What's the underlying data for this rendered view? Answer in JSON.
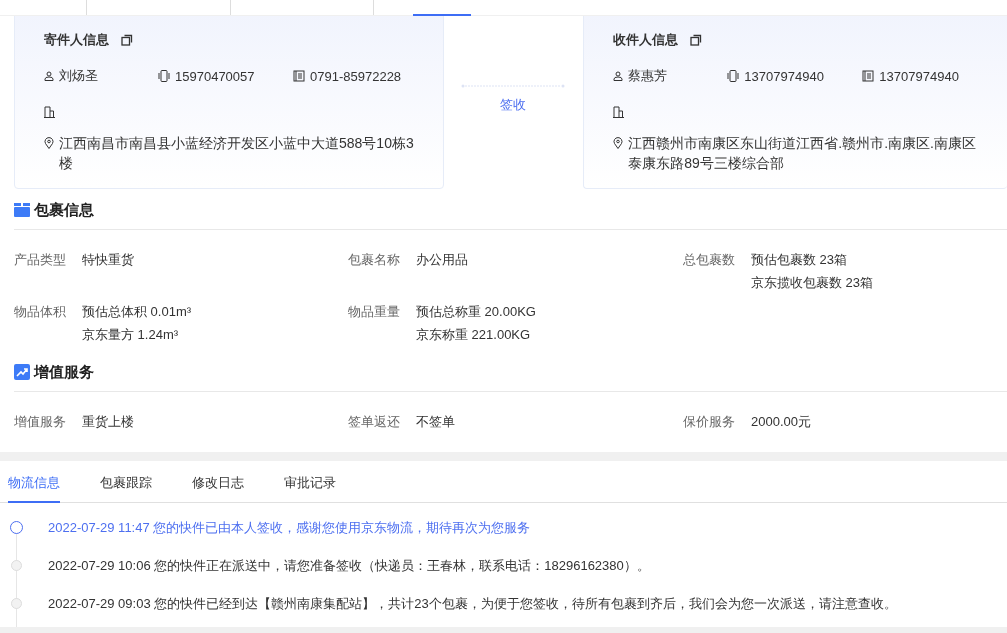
{
  "top_tabs": [
    {
      "selected": false
    },
    {
      "selected": false
    },
    {
      "selected": false
    },
    {
      "selected": true
    }
  ],
  "sender": {
    "title": "寄件人信息",
    "name": "刘炀圣",
    "mobile": "15970470057",
    "phone": "0791-85972228",
    "address": "江西南昌市南昌县小蓝经济开发区小蓝中大道588号10栋3楼"
  },
  "route": {
    "status": "签收"
  },
  "receiver": {
    "title": "收件人信息",
    "name": "蔡惠芳",
    "mobile": "13707974940",
    "phone": "13707974940",
    "address": "江西赣州市南康区东山街道江西省.赣州市.南康区.南康区泰康东路89号三楼综合部"
  },
  "package_section": {
    "title": "包裹信息",
    "fields": [
      {
        "label": "产品类型",
        "values": [
          "特快重货"
        ]
      },
      {
        "label": "包裹名称",
        "values": [
          "办公用品"
        ]
      },
      {
        "label": "总包裹数",
        "values": [
          "预估包裹数 23箱",
          "京东揽收包裹数 23箱"
        ]
      },
      {
        "label": "物品体积",
        "values": [
          "预估总体积 0.01m³",
          "京东量方 1.24m³"
        ]
      },
      {
        "label": "物品重量",
        "values": [
          "预估总称重 20.00KG",
          "京东称重 221.00KG"
        ]
      }
    ]
  },
  "service_section": {
    "title": "增值服务",
    "fields": [
      {
        "label": "增值服务",
        "values": [
          "重货上楼"
        ]
      },
      {
        "label": "签单返还",
        "values": [
          "不签单"
        ]
      },
      {
        "label": "保价服务",
        "values": [
          "2000.00元"
        ]
      }
    ]
  },
  "tabs": [
    {
      "label": "物流信息",
      "selected": true
    },
    {
      "label": "包裹跟踪",
      "selected": false
    },
    {
      "label": "修改日志",
      "selected": false
    },
    {
      "label": "审批记录",
      "selected": false
    }
  ],
  "timeline": [
    {
      "text": "2022-07-29 11:47 您的快件已由本人签收，感谢您使用京东物流，期待再次为您服务",
      "selected": true
    },
    {
      "text": "2022-07-29 10:06 您的快件正在派送中，请您准备签收（快递员：王春林，联系电话：18296162380）。",
      "selected": false
    },
    {
      "text": "2022-07-29 09:03 您的快件已经到达【赣州南康集配站】，共计23个包裹，为便于您签收，待所有包裹到齐后，我们会为您一次派送，请注意查收。",
      "selected": false
    }
  ]
}
